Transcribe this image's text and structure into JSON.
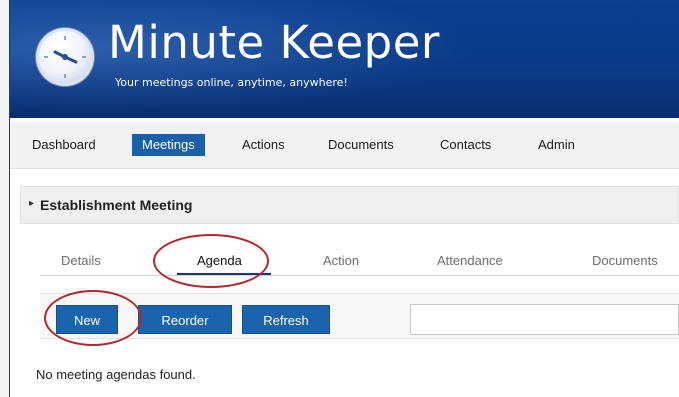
{
  "header": {
    "title": "Minute Keeper",
    "tagline": "Your meetings online, anytime, anywhere!",
    "logo_icon": "clock-icon",
    "colors": {
      "header_bg": "#0a3a86",
      "accent": "#1b64ad",
      "annotation": "#b3262b"
    }
  },
  "nav": {
    "items": [
      {
        "label": "Dashboard"
      },
      {
        "label": "Meetings",
        "active": true
      },
      {
        "label": "Actions"
      },
      {
        "label": "Documents"
      },
      {
        "label": "Contacts"
      },
      {
        "label": "Admin"
      }
    ]
  },
  "meeting": {
    "caret_icon": "triangle-right-icon",
    "title": "Establishment Meeting"
  },
  "tabs": [
    {
      "label": "Details"
    },
    {
      "label": "Agenda",
      "active": true
    },
    {
      "label": "Action"
    },
    {
      "label": "Attendance"
    },
    {
      "label": "Documents"
    }
  ],
  "toolbar": {
    "new_label": "New",
    "reorder_label": "Reorder",
    "refresh_label": "Refresh",
    "search_value": ""
  },
  "content": {
    "empty_message": "No meeting agendas found."
  }
}
